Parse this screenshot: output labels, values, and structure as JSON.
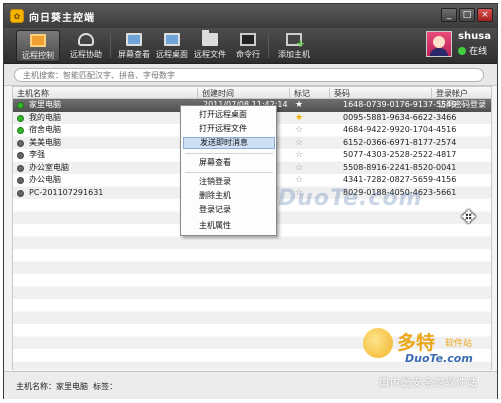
{
  "window": {
    "title": "向日葵主控端",
    "minimize": "_",
    "maximize": "□",
    "close": "×"
  },
  "toolbar": {
    "buttons": [
      {
        "label": "远程控制",
        "icon": "remote-control-icon"
      },
      {
        "label": "远程协助",
        "icon": "remote-assist-icon"
      },
      {
        "label": "屏幕查看",
        "icon": "screen-view-icon"
      },
      {
        "label": "远程桌面",
        "icon": "remote-desktop-icon"
      },
      {
        "label": "远程文件",
        "icon": "remote-file-icon"
      },
      {
        "label": "命令行",
        "icon": "command-line-icon"
      },
      {
        "label": "添加主机",
        "icon": "add-host-icon"
      }
    ]
  },
  "user": {
    "name": "shusa",
    "status": "在线",
    "status_color": "#3fcf3f"
  },
  "search": {
    "placeholder": "主机搜索：智能匹配汉字、拼音、字母数字"
  },
  "table": {
    "columns": [
      "主机名称",
      "创建时间",
      "标记",
      "葵码",
      "登录帐户"
    ],
    "rows": [
      {
        "name": "家里电脑",
        "created": "2011/07/08 11:42:14",
        "starred": true,
        "code": "1648-0739-0176-9137-5549",
        "account": "访问密码登录",
        "online": true,
        "selected": true
      },
      {
        "name": "我的电脑",
        "created": "",
        "starred": true,
        "code": "0095-5881-9634-6622-3466",
        "account": "",
        "online": true,
        "selected": false
      },
      {
        "name": "宿舍电脑",
        "created": "",
        "starred": false,
        "code": "4684-9422-9920-1704-4516",
        "account": "",
        "online": true,
        "selected": false
      },
      {
        "name": "美美电脑",
        "created": "",
        "starred": false,
        "code": "6152-0366-6971-8177-2574",
        "account": "",
        "online": false,
        "selected": false
      },
      {
        "name": "李强",
        "created": "",
        "starred": false,
        "code": "5077-4303-2528-2522-4817",
        "account": "",
        "online": false,
        "selected": false
      },
      {
        "name": "办公室电脑",
        "created": "",
        "starred": false,
        "code": "5508-8916-2241-8520-0041",
        "account": "",
        "online": false,
        "selected": false
      },
      {
        "name": "办公电脑",
        "created": "",
        "starred": false,
        "code": "4341-7282-0827-5659-4156",
        "account": "",
        "online": false,
        "selected": false
      },
      {
        "name": "PC-201107291631",
        "created": "",
        "starred": false,
        "code": "8029-0188-4050-4623-5661",
        "account": "",
        "online": false,
        "selected": false
      }
    ]
  },
  "context_menu": {
    "items": [
      "打开远程桌面",
      "打开远程文件",
      "发送即时消息",
      "屏幕查看",
      "注销登录",
      "删除主机",
      "登录记录",
      "主机属性"
    ],
    "highlighted_index": 2
  },
  "footer": {
    "host_label": "主机名称：",
    "host_value": "家里电脑",
    "tag_label": "标签："
  },
  "watermarks": {
    "center": "www.DuoTe.com",
    "brand": "多特",
    "brand_sub": "软件站",
    "url": "DuoTe.com",
    "slogan": "国内最安全的软件站"
  }
}
